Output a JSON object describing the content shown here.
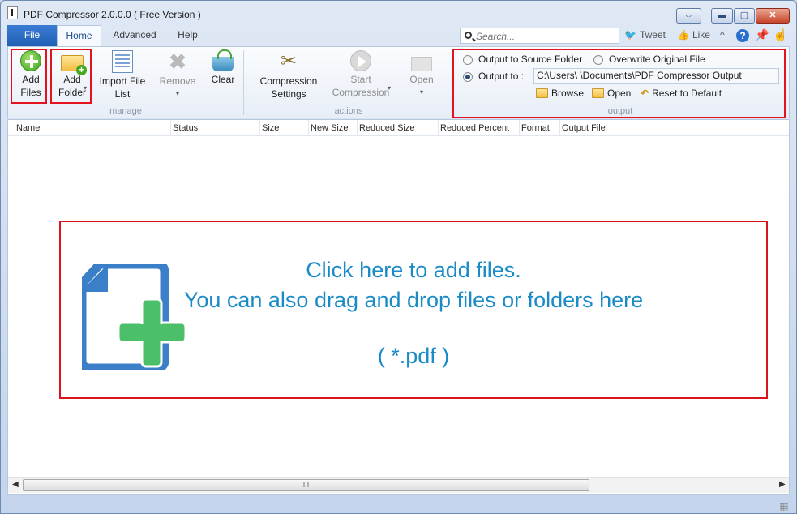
{
  "window": {
    "title": "PDF Compressor 2.0.0.0 ( Free Version )"
  },
  "tabs": {
    "file": "File",
    "home": "Home",
    "advanced": "Advanced",
    "help": "Help"
  },
  "search": {
    "placeholder": "Search..."
  },
  "social": {
    "tweet": "Tweet",
    "like": "Like"
  },
  "ribbon": {
    "manage": {
      "label": "manage",
      "add_files": "Add\nFiles",
      "add_folder": "Add\nFolder",
      "import_list": "Import File\nList",
      "remove": "Remove",
      "clear": "Clear"
    },
    "actions": {
      "label": "actions",
      "compression_settings": "Compression\nSettings",
      "start_compression": "Start\nCompression",
      "open": "Open"
    },
    "output": {
      "label": "output",
      "source_folder": "Output to Source Folder",
      "overwrite": "Overwrite Original File",
      "output_to": "Output to :",
      "path": "C:\\Users\\            \\Documents\\PDF Compressor Output",
      "browse": "Browse",
      "open": "Open",
      "reset": "Reset to Default"
    }
  },
  "columns": [
    "Name",
    "Status",
    "Size",
    "New Size",
    "Reduced Size",
    "Reduced Percent",
    "Format",
    "Output File"
  ],
  "dropzone": {
    "line1": "Click here to add files.",
    "line2": "You can also drag and drop files or folders here",
    "line3": "( *.pdf )"
  },
  "scrollbar": {
    "grip": "III"
  },
  "colors": {
    "accent": "#1f5fb4",
    "highlight": "#e3121e",
    "dropText": "#1a8bc6",
    "fileIconBlue": "#3b7fc9",
    "plusGreen": "#4cbf6a"
  }
}
